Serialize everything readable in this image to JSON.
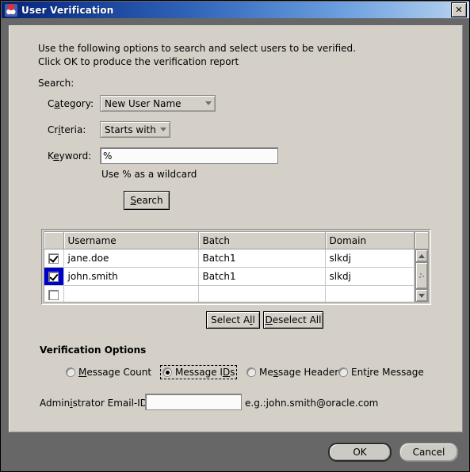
{
  "window": {
    "title": "User Verification",
    "icon": "app-duke-icon",
    "close_label": "✕",
    "accent_title_bar": "#0a2d86",
    "panel_background": "#d4d0c8",
    "frame_background": "#676767",
    "selection_color": "#0000cd"
  },
  "intro": {
    "line1": "Use the following options to search and select users to be verified.",
    "line2": "Click OK to produce the verification report",
    "search_section_label": "Search:"
  },
  "form": {
    "category": {
      "label_pre": "C",
      "label_mnemonic": "a",
      "label_post": "tegory:",
      "label_full": "Category:",
      "value": "New User Name"
    },
    "criteria": {
      "label_pre": "Cr",
      "label_mnemonic": "i",
      "label_post": "teria:",
      "label_full": "Criteria:",
      "value": "Starts with"
    },
    "keyword": {
      "label_pre": "K",
      "label_mnemonic": "e",
      "label_post": "yword:",
      "label_full": "Keyword:",
      "value": "%",
      "placeholder": "",
      "hint": "Use % as a wildcard"
    },
    "search_button": {
      "label_pre": "",
      "label_mnemonic": "S",
      "label_post": "earch",
      "label_full": "Search"
    }
  },
  "table": {
    "columns": [
      "",
      "Username",
      "Batch",
      "Domain"
    ],
    "rows": [
      {
        "checked": true,
        "selected": false,
        "username": "jane.doe",
        "batch": "Batch1",
        "domain": "slkdj"
      },
      {
        "checked": true,
        "selected": true,
        "username": "john.smith",
        "batch": "Batch1",
        "domain": "slkdj"
      },
      {
        "checked": false,
        "selected": false,
        "username": "",
        "batch": "",
        "domain": ""
      }
    ],
    "scrollbar": {
      "up_arrow": "▲",
      "down_arrow": "▼"
    }
  },
  "table_actions": {
    "select_all": {
      "label_pre": "Select A",
      "label_mnemonic": "l",
      "label_post": "l",
      "label_full": "Select All"
    },
    "deselect_all": {
      "label_pre": "",
      "label_mnemonic": "D",
      "label_post": "eselect All",
      "label_full": "Deselect All"
    }
  },
  "verification_options": {
    "title": "Verification Options",
    "selected": "Message IDs",
    "options": [
      {
        "label_pre": "",
        "label_mnemonic": "M",
        "label_post": "essage Count",
        "label_full": "Message Count",
        "checked": false,
        "focused": false
      },
      {
        "label_pre": "Message I",
        "label_mnemonic": "D",
        "label_post": "s",
        "label_full": "Message IDs",
        "checked": true,
        "focused": true
      },
      {
        "label_pre": "Me",
        "label_mnemonic": "s",
        "label_post": "sage Header",
        "label_full": "Message Header",
        "checked": false,
        "focused": false
      },
      {
        "label_pre": "Ent",
        "label_mnemonic": "i",
        "label_post": "re Message",
        "label_full": "Entire Message",
        "checked": false,
        "focused": false
      }
    ]
  },
  "admin_email": {
    "label_pre": "Admin",
    "label_mnemonic": "i",
    "label_post": "strator Email-ID",
    "label_full": "Administrator Email-ID",
    "value": "",
    "placeholder": "",
    "hint": "e.g.:john.smith@oracle.com"
  },
  "footer": {
    "ok_label": "OK",
    "cancel_label": "Cancel"
  }
}
